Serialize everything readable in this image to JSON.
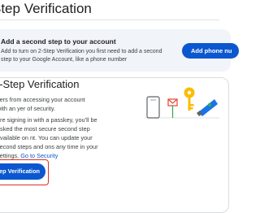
{
  "header": {
    "title": "Step Verification"
  },
  "banner": {
    "title": "Add a second step to your account",
    "description": "Add to turn on 2-Step Verification you first need to add a second step to your Google Account, like a phone number",
    "button_label": "Add phone nu"
  },
  "card": {
    "title": "2-Step Verification",
    "intro": "kers from accessing your account with an yer of security.",
    "passkey_text": "ere signing in with a passkey, you’ll be asked the most secure second step available on nt. You can update your second steps and ons any time in your settings.",
    "link_label": "Go to Security",
    "cta_label": "-Step Verification"
  },
  "illustration": {
    "icons": [
      "phone-icon",
      "mail-icon",
      "key-icon",
      "security-key-icon"
    ]
  },
  "colors": {
    "accent": "#0b57d0",
    "highlight": "#d93025",
    "banner_bg": "#f1f4f9"
  }
}
